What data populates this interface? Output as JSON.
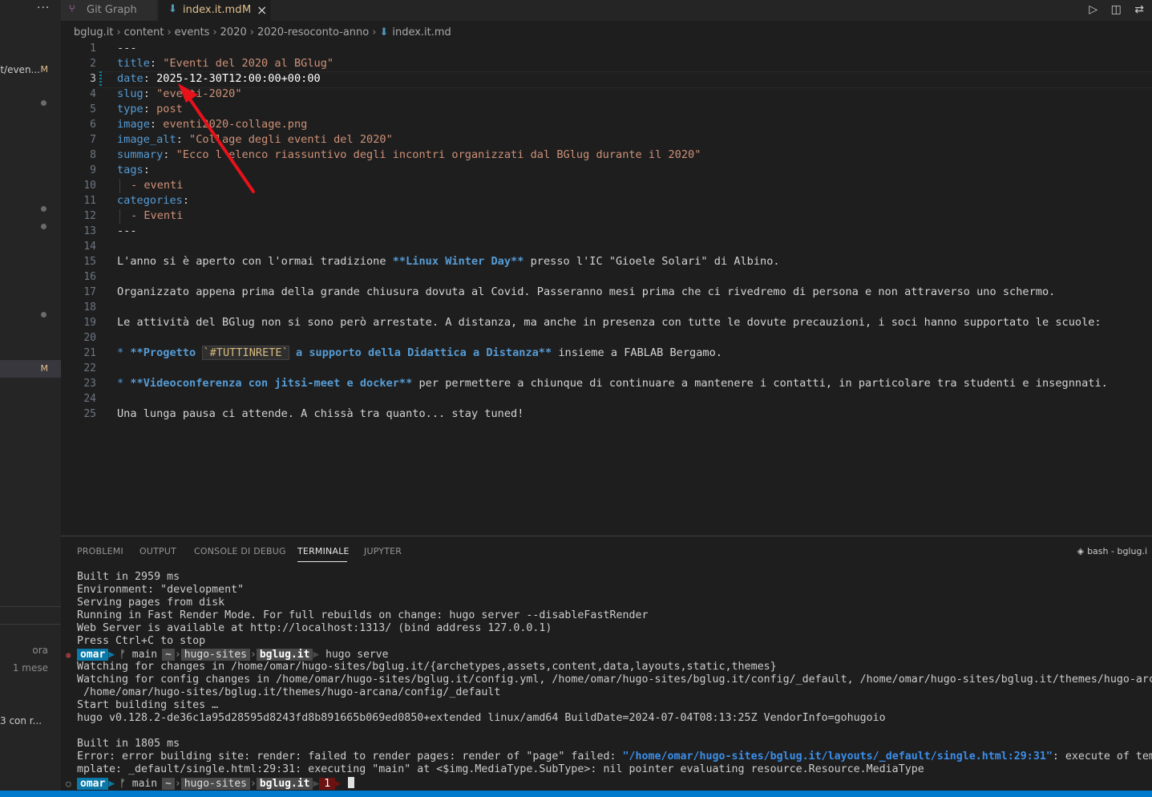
{
  "sidebar": {
    "menu_dots": "···",
    "file_label": "t/even...",
    "file_badge": "M",
    "selected_badge": "M",
    "commit_times": [
      "ora",
      "1 mese"
    ],
    "commit_text": "3 con r..."
  },
  "tabs": [
    {
      "label": "Git Graph"
    },
    {
      "label": "index.it.md",
      "badge": "M",
      "close": "×"
    }
  ],
  "breadcrumb": [
    "bglug.it",
    "content",
    "events",
    "2020",
    "2020-resoconto-anno",
    "index.it.md"
  ],
  "editor": {
    "line_numbers": [
      "1",
      "2",
      "3",
      "4",
      "5",
      "6",
      "7",
      "8",
      "9",
      "10",
      "11",
      "12",
      "13",
      "14",
      "15",
      "16",
      "17",
      "18",
      "19",
      "20",
      "21",
      "22",
      "23",
      "24",
      "25"
    ],
    "lines": {
      "l1": "---",
      "l2_key": "title",
      "l2_val": "\"Eventi del 2020 al BGlug\"",
      "l3_key": "date",
      "l3_val": "2025-12-30T12:00:00+00:00",
      "l4_key": "slug",
      "l4_val": "\"eventi-2020\"",
      "l5_key": "type",
      "l5_val": "post",
      "l6_key": "image",
      "l6_val": "eventi2020-collage.png",
      "l7_key": "image_alt",
      "l7_val": "\"Collage degli eventi del 2020\"",
      "l8_key": "summary",
      "l8_val": "\"Ecco l'elenco riassuntivo degli incontri organizzati dal BGlug durante il 2020\"",
      "l9_key": "tags",
      "l10": "- eventi",
      "l11_key": "categories",
      "l12": "- Eventi",
      "l13": "---",
      "l15_a": "L'anno si è aperto con l'ormai tradizione ",
      "l15_b": "**Linux Winter Day**",
      "l15_c": " presso l'IC \"Gioele Solari\" di Albino.",
      "l17": "Organizzato appena prima della grande chiusura dovuta al Covid. Passeranno mesi prima che ci rivedremo di persona e non attraverso uno schermo.",
      "l19": "Le attività del BGlug non si sono però arrestate. A distanza, ma anche in presenza con tutte le dovute precauzioni, i soci hanno supportato le scuole:",
      "l21_bullet": "*",
      "l21_a": "**Progetto ",
      "l21_code": "`#TUTTINRETE`",
      "l21_b": " a supporto della Didattica a Distanza**",
      "l21_c": " insieme a FABLAB Bergamo.",
      "l23_bullet": "*",
      "l23_a": "**Videoconferenza con jitsi-meet e docker**",
      "l23_b": " per permettere a chiunque di continuare a mantenere i contatti, in particolare tra studenti e insegnnati.",
      "l25": "Una lunga pausa ci attende. A chissà tra quanto... stay tuned!"
    }
  },
  "panel": {
    "tabs": [
      "PROBLEMI",
      "OUTPUT",
      "CONSOLE DI DEBUG",
      "TERMINALE",
      "JUPYTER"
    ],
    "active_tab": "TERMINALE",
    "terminal_label": "bash - bglug.i",
    "lines": {
      "t1": "Built in 2959 ms",
      "t2": "Environment: \"development\"",
      "t3": "Serving pages from disk",
      "t4": "Running in Fast Render Mode. For full rebuilds on change: hugo server --disableFastRender",
      "t5": "Web Server is available at http://localhost:1313/ (bind address 127.0.0.1)",
      "t6": "Press Ctrl+C to stop",
      "t8": "Watching for changes in /home/omar/hugo-sites/bglug.it/{archetypes,assets,content,data,layouts,static,themes}",
      "t9": "Watching for config changes in /home/omar/hugo-sites/bglug.it/config.yml, /home/omar/hugo-sites/bglug.it/config/_default, /home/omar/hugo-sites/bglug.it/themes/hugo-arc",
      "t10": " /home/omar/hugo-sites/bglug.it/themes/hugo-arcana/config/_default",
      "t11": "Start building sites …",
      "t12": "hugo v0.128.2-de36c1a95d28595d8243fd8b891665b069ed0850+extended linux/amd64 BuildDate=2024-07-04T08:13:25Z VendorInfo=gohugoio",
      "t14": "Built in 1805 ms",
      "t15_a": "Error: error building site: render: failed to render pages: render of \"page\" failed: ",
      "t15_path": "\"/home/omar/hugo-sites/bglug.it/layouts/_default/single.html:29:31\"",
      "t15_b": ": execute of tem",
      "t16": "mplate: _default/single.html:29:31: executing \"main\" at <$img.MediaType.SubType>: nil pointer evaluating resource.Resource.MediaType"
    },
    "prompt1": {
      "status": "⊗",
      "user": "omar",
      "branch": "ᚠ main",
      "home": "~",
      "dir1": "hugo-sites",
      "dir2": "bglug.it",
      "command": "hugo serve"
    },
    "prompt2": {
      "status": "○",
      "user": "omar",
      "branch": "ᚠ main",
      "home": "~",
      "dir1": "hugo-sites",
      "dir2": "bglug.it",
      "exit_code": "1"
    }
  },
  "colors": {
    "accent": "#007acc",
    "modified": "#e2c08d",
    "error": "#f14c4c",
    "annotation_arrow": "#e8121a"
  }
}
